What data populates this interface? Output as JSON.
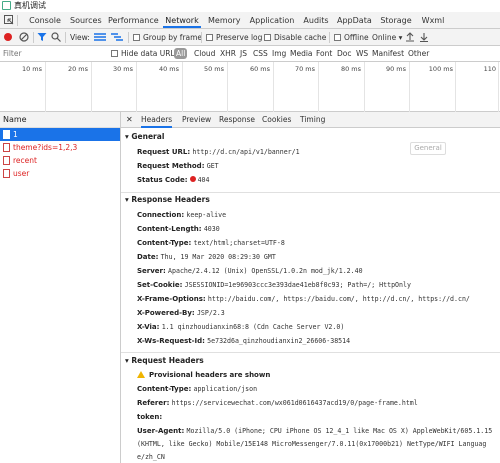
{
  "window": {
    "title": "真机调试"
  },
  "tabs": [
    "Console",
    "Sources",
    "Performance",
    "Network",
    "Memory",
    "Application",
    "Audits",
    "AppData",
    "Storage",
    "Wxml"
  ],
  "toolbar": {
    "view_label": "View:",
    "group_by_frame": "Group by frame",
    "preserve_log": "Preserve log",
    "disable_cache": "Disable cache",
    "offline": "Offline",
    "throttle": "Online"
  },
  "filter": {
    "placeholder": "Filter",
    "hide_data_urls": "Hide data URLs",
    "types": [
      "All",
      "Cloud",
      "XHR",
      "JS",
      "CSS",
      "Img",
      "Media",
      "Font",
      "Doc",
      "WS",
      "Manifest",
      "Other"
    ]
  },
  "timeline_ticks": [
    "10 ms",
    "20 ms",
    "30 ms",
    "40 ms",
    "50 ms",
    "60 ms",
    "70 ms",
    "80 ms",
    "90 ms",
    "100 ms",
    "110"
  ],
  "requests": {
    "header": "Name",
    "items": [
      "1",
      "theme?ids=1,2,3",
      "recent",
      "user"
    ]
  },
  "detail_tabs": [
    "Headers",
    "Preview",
    "Response",
    "Cookies",
    "Timing"
  ],
  "general": {
    "title": "General",
    "button": "General",
    "rows": [
      {
        "k": "Request URL:",
        "v": "http://d.cn/api/v1/banner/1"
      },
      {
        "k": "Request Method:",
        "v": "GET"
      },
      {
        "k": "Status Code:",
        "v": "404"
      }
    ]
  },
  "response_headers": {
    "title": "Response Headers",
    "rows": [
      {
        "k": "Connection:",
        "v": "keep-alive"
      },
      {
        "k": "Content-Length:",
        "v": "4030"
      },
      {
        "k": "Content-Type:",
        "v": "text/html;charset=UTF-8"
      },
      {
        "k": "Date:",
        "v": "Thu, 19 Mar 2020 08:29:30 GMT"
      },
      {
        "k": "Server:",
        "v": "Apache/2.4.12 (Unix) OpenSSL/1.0.2n mod_jk/1.2.40"
      },
      {
        "k": "Set-Cookie:",
        "v": "JSESSIONID=1e96903ccc3e393dae41eb8f0c93; Path=/; HttpOnly"
      },
      {
        "k": "X-Frame-Options:",
        "v": "http://baidu.com/, https://baidu.com/, http://d.cn/, https://d.cn/"
      },
      {
        "k": "X-Powered-By:",
        "v": "JSP/2.3"
      },
      {
        "k": "X-Via:",
        "v": "1.1 qinzhoudianxin68:8 (Cdn Cache Server V2.0)"
      },
      {
        "k": "X-Ws-Request-Id:",
        "v": "5e732d6a_qinzhoudianxin2_26606-38514"
      }
    ]
  },
  "request_headers": {
    "title": "Request Headers",
    "warning": "Provisional headers are shown",
    "rows": [
      {
        "k": "Content-Type:",
        "v": "application/json"
      },
      {
        "k": "Referer:",
        "v": "https://servicewechat.com/wx061d0616437acd19/0/page-frame.html"
      },
      {
        "k": "token:",
        "v": ""
      },
      {
        "k": "User-Agent:",
        "v": "Mozilla/5.0 (iPhone; CPU iPhone OS 12_4_1 like Mac OS X) AppleWebKit/605.1.15"
      }
    ],
    "ua_cont1": "(KHTML, like Gecko) Mobile/15E148 MicroMessenger/7.0.11(0x17000b21) NetType/WIFI Languag",
    "ua_cont2": "e/zh_CN"
  },
  "colors": {
    "accent": "#1a73e8",
    "error": "#dd2222",
    "record": "#dd2222"
  }
}
